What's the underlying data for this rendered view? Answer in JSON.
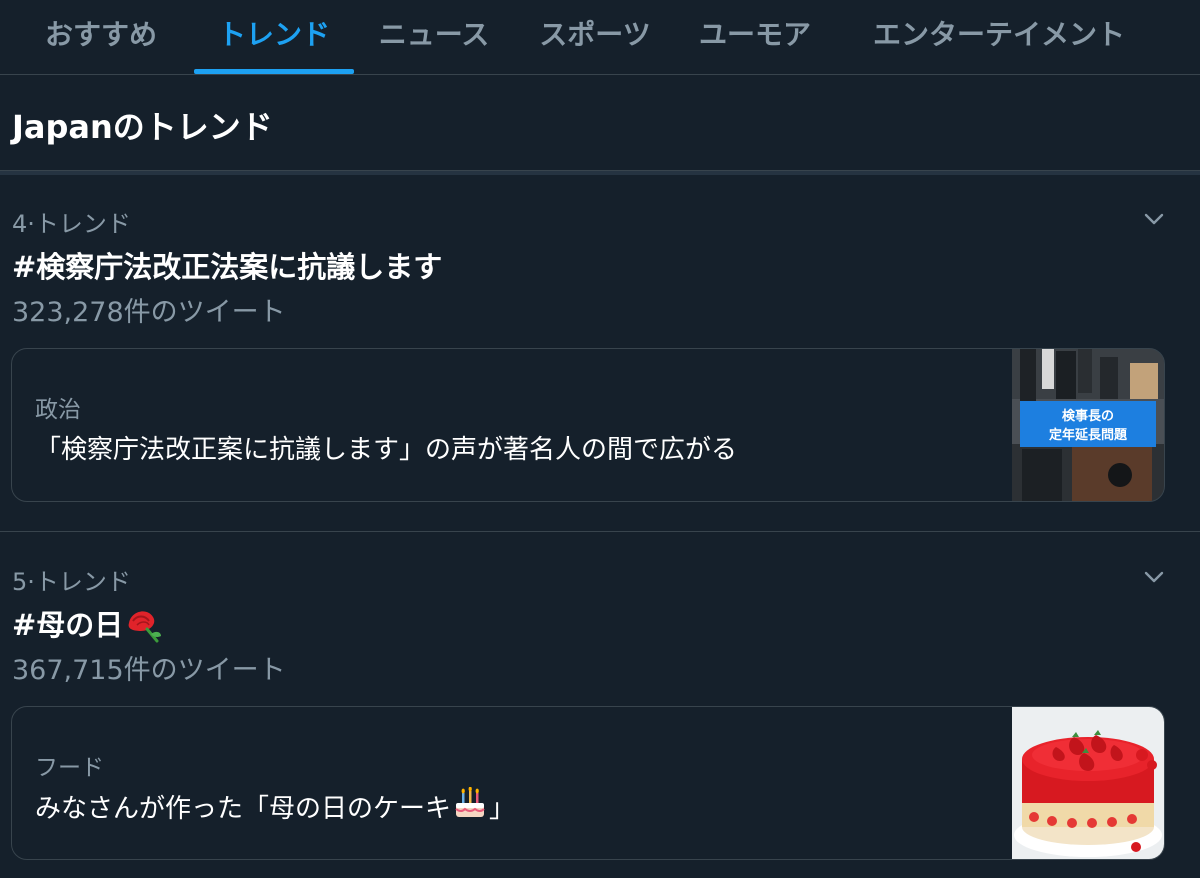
{
  "tabs": [
    {
      "label": "おすすめ",
      "active": false
    },
    {
      "label": "トレンド",
      "active": true
    },
    {
      "label": "ニュース",
      "active": false
    },
    {
      "label": "スポーツ",
      "active": false
    },
    {
      "label": "ユーモア",
      "active": false
    },
    {
      "label": "エンターテイメント",
      "active": false
    }
  ],
  "section": {
    "title": "Japanのトレンド"
  },
  "trends": [
    {
      "meta": "4·トレンド",
      "name": "#検察庁法改正法案に抗議します",
      "count": "323,278件のツイート",
      "card": {
        "category": "政治",
        "text": "「検察庁法改正案に抗議します」の声が著名人の間で広がる",
        "thumb_caption_line1": "検事長の",
        "thumb_caption_line2": "定年延長問題"
      }
    },
    {
      "meta": "5·トレンド",
      "name": "#母の日",
      "name_emoji": "rose-emoji",
      "count": "367,715件のツイート",
      "card": {
        "category": "フード",
        "text_before": "みなさんが作った「母の日のケーキ",
        "text_emoji": "birthday-cake-emoji",
        "text_after": "」"
      }
    }
  ],
  "colors": {
    "background": "#15202b",
    "accent": "#1da1f2",
    "secondary_text": "#8899a6",
    "border": "#38444d"
  }
}
